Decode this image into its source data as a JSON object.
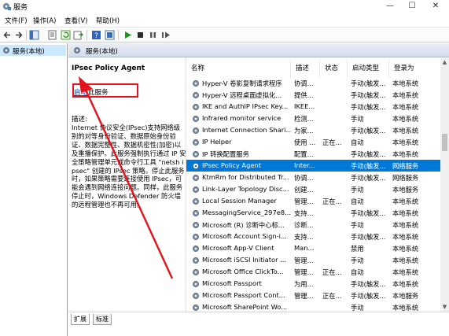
{
  "window": {
    "title": "服务",
    "controls": {
      "minimize": "—",
      "maximize": "☐",
      "close": "✕"
    }
  },
  "menu": [
    {
      "label": "文件(F)"
    },
    {
      "label": "操作(A)"
    },
    {
      "label": "查看(V)"
    },
    {
      "label": "帮助(H)"
    }
  ],
  "toolbar": {
    "icons": [
      "back-icon",
      "forward-icon",
      "console-tree-icon",
      "properties-icon",
      "refresh-icon",
      "export-icon",
      "help-icon",
      "show-hide-icon",
      "start-icon",
      "stop-icon",
      "pause-icon",
      "restart-icon"
    ]
  },
  "tree": {
    "root_label": "服务(本地)"
  },
  "content_header": {
    "title": "服务(本地)"
  },
  "description": {
    "service_name": "IPsec Policy Agent",
    "start_link": "启动",
    "start_suffix": "此服务",
    "label": "描述:",
    "text": "Internet 协议安全(IPsec)支持网络级别的对等身份验证、数据原始身份验证、数据完整性、数据机密性(加密)以及重播保护。此服务强制执行通过 IP 安全策略管理单元或命令行工具 \"netsh ipsec\" 创建的 IPsec 策略。停止此服务时，如果策略需要连接使用 IPsec，可能会遇到网络连接问题。同样，此服务停止时，Windows Defender 防火墙的远程管理也不再可用。"
  },
  "tabs": [
    {
      "label": "扩展"
    },
    {
      "label": "标准"
    }
  ],
  "columns": [
    "名称",
    "描述",
    "状态",
    "启动类型",
    "登录为"
  ],
  "services": [
    {
      "name": "Hyper-V 卷影复制请求程序",
      "desc": "协调...",
      "status": "",
      "startup": "手动(触发...",
      "logon": "本地系统"
    },
    {
      "name": "Hyper-V 远程桌面虚拟化...",
      "desc": "提供...",
      "status": "",
      "startup": "手动(触发...",
      "logon": "本地系统"
    },
    {
      "name": "IKE and AuthIP IPsec Key...",
      "desc": "IKEE...",
      "status": "",
      "startup": "手动(触发...",
      "logon": "本地系统"
    },
    {
      "name": "Infrared monitor service",
      "desc": "检测...",
      "status": "",
      "startup": "手动",
      "logon": "本地系统"
    },
    {
      "name": "Internet Connection Shari...",
      "desc": "为家...",
      "status": "",
      "startup": "手动(触发...",
      "logon": "本地系统"
    },
    {
      "name": "IP Helper",
      "desc": "使用 ...",
      "status": "正在...",
      "startup": "自动",
      "logon": "本地系统"
    },
    {
      "name": "IP 转换配置服务",
      "desc": "配置...",
      "status": "",
      "startup": "手动(触发...",
      "logon": "本地系统"
    },
    {
      "name": "IPsec Policy Agent",
      "desc": "Inter...",
      "status": "",
      "startup": "手动(触发...",
      "logon": "网络服务",
      "selected": true
    },
    {
      "name": "KtmRm for Distributed Tr...",
      "desc": "协调...",
      "status": "",
      "startup": "手动(触发...",
      "logon": "网络服务"
    },
    {
      "name": "Link-Layer Topology Disc...",
      "desc": "创建...",
      "status": "",
      "startup": "手动",
      "logon": "本地服务"
    },
    {
      "name": "Local Session Manager",
      "desc": "管理...",
      "status": "正在...",
      "startup": "自动",
      "logon": "本地系统"
    },
    {
      "name": "MessagingService_297e8...",
      "desc": "支持...",
      "status": "",
      "startup": "手动(触发...",
      "logon": "本地系统"
    },
    {
      "name": "Microsoft (R) 诊断中心标...",
      "desc": "诊断...",
      "status": "",
      "startup": "手动",
      "logon": "本地系统"
    },
    {
      "name": "Microsoft Account Sign-i...",
      "desc": "支持...",
      "status": "",
      "startup": "手动(触发...",
      "logon": "本地系统"
    },
    {
      "name": "Microsoft App-V Client",
      "desc": "Man...",
      "status": "",
      "startup": "禁用",
      "logon": "本地系统"
    },
    {
      "name": "Microsoft iSCSI Initiator ...",
      "desc": "管理...",
      "status": "",
      "startup": "手动",
      "logon": "本地系统"
    },
    {
      "name": "Microsoft Office ClickTo...",
      "desc": "管理...",
      "status": "正在...",
      "startup": "自动",
      "logon": "本地系统"
    },
    {
      "name": "Microsoft Passport",
      "desc": "为用...",
      "status": "",
      "startup": "手动(触发...",
      "logon": "本地系统"
    },
    {
      "name": "Microsoft Passport Cont...",
      "desc": "管理...",
      "status": "正在...",
      "startup": "手动(触发...",
      "logon": "本地服务"
    },
    {
      "name": "Microsoft SharePoint Wo...",
      "desc": "",
      "status": "",
      "startup": "手动",
      "logon": "本地系统"
    }
  ],
  "scrollbar": {
    "up": "▲",
    "down": "▼"
  },
  "colors": {
    "selection": "#0078d7",
    "annotation": "#e5111b",
    "link": "#0645ad",
    "header_blue": "#d3dceb"
  }
}
